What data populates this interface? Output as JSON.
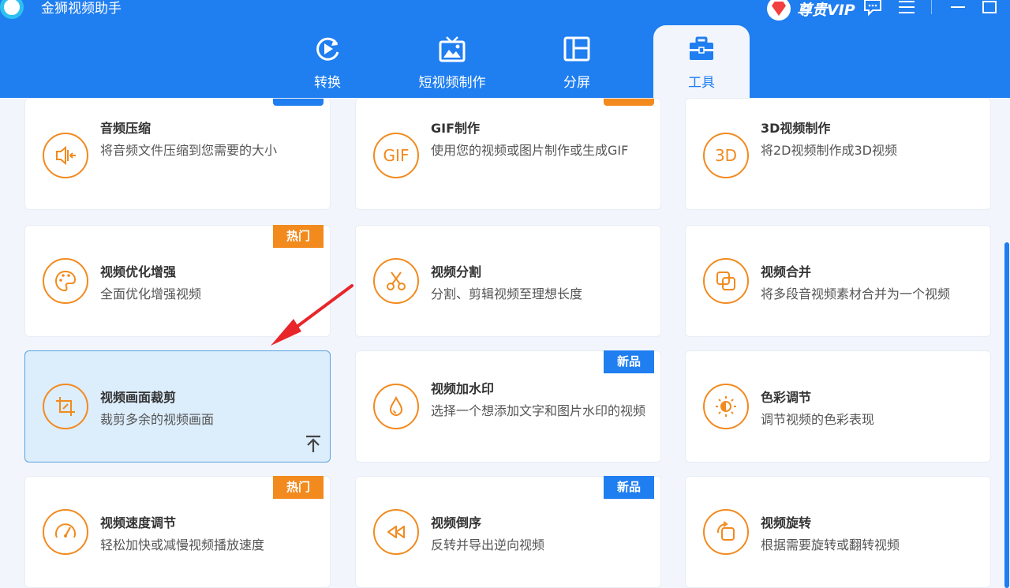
{
  "app": {
    "title": "金狮视频助手",
    "vip_label": "尊贵VIP"
  },
  "tabs": [
    {
      "label": "转换"
    },
    {
      "label": "短视频制作"
    },
    {
      "label": "分屏"
    },
    {
      "label": "工具"
    }
  ],
  "cards": [
    {
      "title": "音频压缩",
      "desc": "将音频文件压缩到您需要的大小",
      "icon": "speaker-compress-icon"
    },
    {
      "title": "GIF制作",
      "desc": "使用您的视频或图片制作或生成GIF",
      "icon": "gif-icon",
      "icon_text": "GIF"
    },
    {
      "title": "3D视频制作",
      "desc": "将2D视频制作成3D视频",
      "icon": "3d-icon",
      "icon_text": "3D"
    },
    {
      "title": "视频优化增强",
      "desc": "全面优化增强视频",
      "icon": "palette-icon",
      "badge": "热门"
    },
    {
      "title": "视频分割",
      "desc": "分割、剪辑视频至理想长度",
      "icon": "scissors-icon"
    },
    {
      "title": "视频合并",
      "desc": "将多段音视频素材合并为一个视频",
      "icon": "merge-icon"
    },
    {
      "title": "视频画面裁剪",
      "desc": "裁剪多余的视频画面",
      "icon": "crop-icon"
    },
    {
      "title": "视频加水印",
      "desc": "选择一个想添加文字和图片水印的视频",
      "icon": "watermark-drop-icon",
      "badge": "新品"
    },
    {
      "title": "色彩调节",
      "desc": "调节视频的色彩表现",
      "icon": "sun-color-icon"
    },
    {
      "title": "视频速度调节",
      "desc": "轻松加快或减慢视频播放速度",
      "icon": "speedometer-icon",
      "badge": "热门"
    },
    {
      "title": "视频倒序",
      "desc": "反转并导出逆向视频",
      "icon": "rewind-icon",
      "badge": "新品"
    },
    {
      "title": "视频旋转",
      "desc": "根据需要旋转或翻转视频",
      "icon": "rotate-icon"
    }
  ],
  "colors": {
    "header_blue": "#1f7ef0",
    "accent_orange": "#f28a1e",
    "selected_bg": "#dcedfc"
  }
}
